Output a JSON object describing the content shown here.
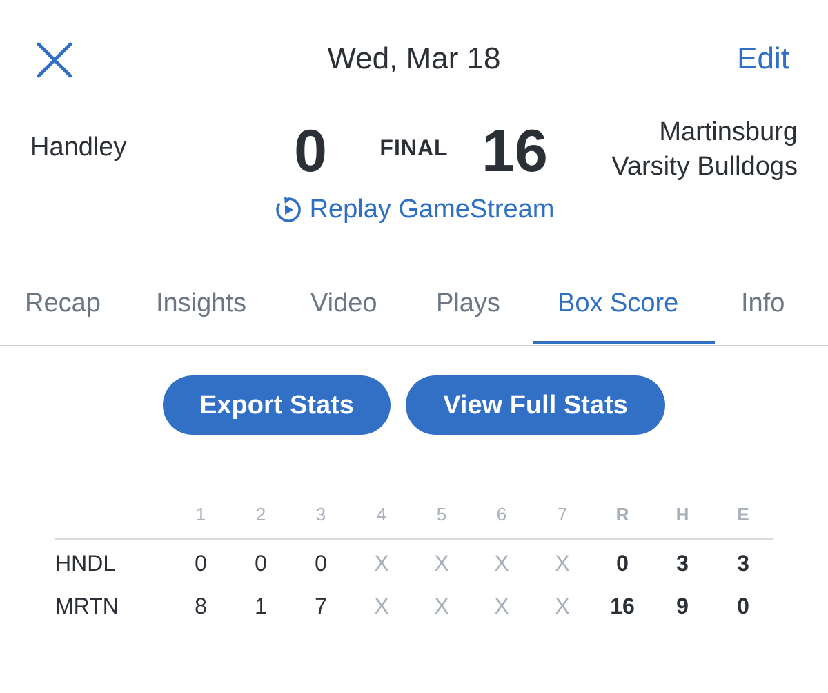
{
  "header": {
    "date": "Wed, Mar 18",
    "edit_label": "Edit"
  },
  "scoreboard": {
    "home_team": "Handley",
    "home_score": "0",
    "status": "FINAL",
    "away_score": "16",
    "away_team_line1": "Martinsburg",
    "away_team_line2": "Varsity Bulldogs",
    "replay_label": "Replay GameStream"
  },
  "tabs": [
    {
      "label": "Recap"
    },
    {
      "label": "Insights"
    },
    {
      "label": "Video"
    },
    {
      "label": "Plays"
    },
    {
      "label": "Box Score"
    },
    {
      "label": "Info"
    }
  ],
  "active_tab": "Box Score",
  "buttons": {
    "export": "Export Stats",
    "view_full": "View Full Stats"
  },
  "box_score": {
    "headers": [
      "1",
      "2",
      "3",
      "4",
      "5",
      "6",
      "7",
      "R",
      "H",
      "E"
    ],
    "rows": [
      {
        "team": "HNDL",
        "cells": [
          "0",
          "0",
          "0",
          "X",
          "X",
          "X",
          "X",
          "0",
          "3",
          "3"
        ]
      },
      {
        "team": "MRTN",
        "cells": [
          "8",
          "1",
          "7",
          "X",
          "X",
          "X",
          "X",
          "16",
          "9",
          "0"
        ]
      }
    ]
  },
  "colors": {
    "accent": "#2f6fc4",
    "text": "#2b2f36",
    "muted": "#6b7785",
    "faint": "#a7b0bb"
  }
}
